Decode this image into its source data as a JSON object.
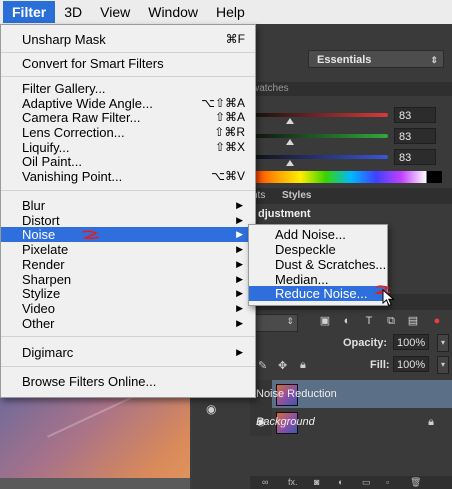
{
  "menubar": {
    "items": [
      "Filter",
      "3D",
      "View",
      "Window",
      "Help"
    ],
    "active": "Filter"
  },
  "filter_menu": {
    "items": [
      {
        "label": "Unsharp Mask",
        "shortcut": "⌘F"
      },
      {
        "label": "Convert for Smart Filters",
        "shortcut": ""
      },
      {
        "label": "Filter Gallery...",
        "shortcut": ""
      },
      {
        "label": "Adaptive Wide Angle...",
        "shortcut": "⌥⇧⌘A"
      },
      {
        "label": "Camera Raw Filter...",
        "shortcut": "⇧⌘A"
      },
      {
        "label": "Lens Correction...",
        "shortcut": "⇧⌘R"
      },
      {
        "label": "Liquify...",
        "shortcut": "⇧⌘X"
      },
      {
        "label": "Oil Paint...",
        "shortcut": ""
      },
      {
        "label": "Vanishing Point...",
        "shortcut": "⌥⌘V"
      },
      {
        "label": "Blur",
        "shortcut": ""
      },
      {
        "label": "Distort",
        "shortcut": ""
      },
      {
        "label": "Noise",
        "shortcut": ""
      },
      {
        "label": "Pixelate",
        "shortcut": ""
      },
      {
        "label": "Render",
        "shortcut": ""
      },
      {
        "label": "Sharpen",
        "shortcut": ""
      },
      {
        "label": "Stylize",
        "shortcut": ""
      },
      {
        "label": "Video",
        "shortcut": ""
      },
      {
        "label": "Other",
        "shortcut": ""
      },
      {
        "label": "Digimarc",
        "shortcut": ""
      },
      {
        "label": "Browse Filters Online...",
        "shortcut": ""
      }
    ]
  },
  "noise_submenu": {
    "items": [
      "Add Noise...",
      "Despeckle",
      "Dust & Scratches...",
      "Median...",
      "Reduce Noise..."
    ],
    "highlighted": "Reduce Noise..."
  },
  "workspace": {
    "preset": "Essentials",
    "swatches_tab": "watches",
    "color_sliders": [
      {
        "value": "83",
        "color": "#d93a3a",
        "level": 0.28
      },
      {
        "value": "83",
        "color": "#2faa3a",
        "level": 0.28
      },
      {
        "value": "83",
        "color": "#3a55d9",
        "level": 0.28
      }
    ],
    "adjustments_tabs": [
      "nts",
      "Styles"
    ],
    "adjustment_title": "djustment",
    "opacity_label": "Opacity:",
    "opacity_value": "100%",
    "fill_label": "Fill:",
    "fill_value": "100%",
    "layers": [
      {
        "name": "Noise Reduction",
        "selected": true
      },
      {
        "name": "Background",
        "selected": false
      }
    ]
  },
  "colors": {
    "menu_highlight": "#2f6fdd",
    "selected_layer": "#5b6f87",
    "annotation_scribble": "#e02020"
  }
}
